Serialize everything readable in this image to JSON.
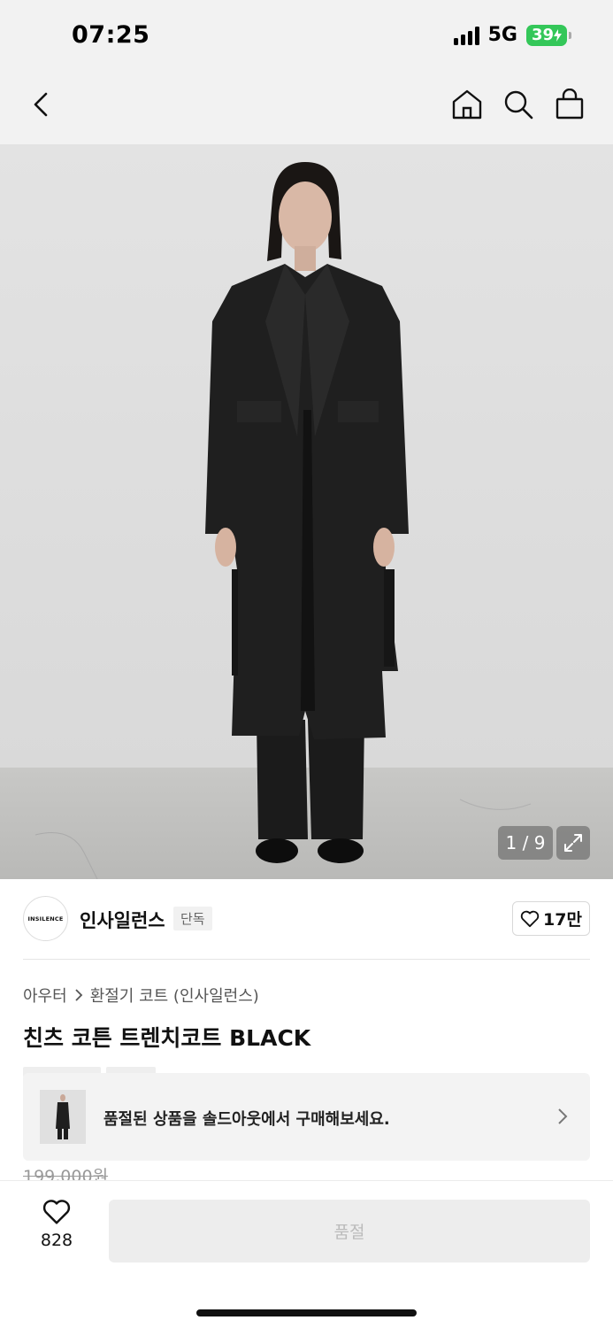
{
  "status_bar": {
    "time": "07:25",
    "network": "5G",
    "battery": "39"
  },
  "nav": {
    "icons": [
      "back-icon",
      "home-icon",
      "search-icon",
      "shopping-bag-icon"
    ]
  },
  "gallery": {
    "counter": "1 / 9",
    "expand_icon": "expand-icon"
  },
  "brand": {
    "logo_text": "INSILENCE",
    "name": "인사일런스",
    "badge": "단독",
    "like_count": "17만"
  },
  "product": {
    "breadcrumb": [
      "아우터",
      "환절기 코트 (인사일런스)"
    ],
    "title": "친츠 코튼 트렌치코트 BLACK",
    "original_price": "199,000원"
  },
  "soldout_banner": {
    "text": "품절된 상품을 솔드아웃에서 구매해보세요."
  },
  "bottom_bar": {
    "like_count": "828",
    "buy_label": "품절"
  },
  "colors": {
    "background": "#ffffff",
    "header_bg": "#f2f2f2",
    "battery": "#34c759",
    "disabled_button_bg": "#ededed",
    "disabled_button_text": "#bbbbbb"
  }
}
